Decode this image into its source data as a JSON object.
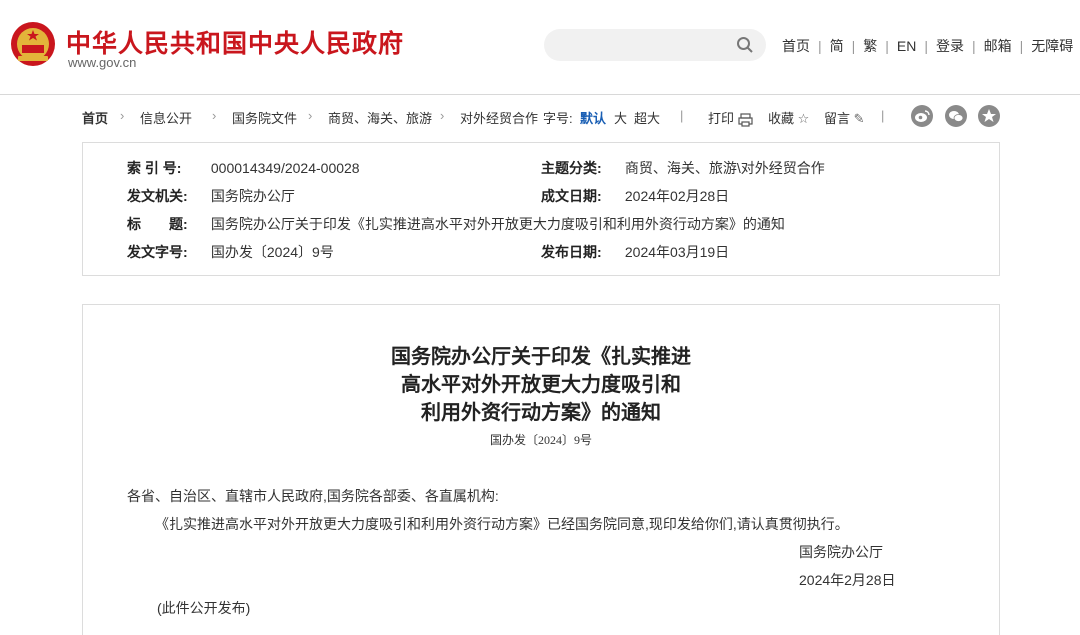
{
  "header": {
    "site_title": "中华人民共和国中央人民政府",
    "site_url": "www.gov.cn",
    "search_placeholder": "",
    "nav": [
      "首页",
      "简",
      "繁",
      "EN",
      "登录",
      "邮箱",
      "无障碍"
    ],
    "colors": {
      "brand_red": "#c9161d"
    }
  },
  "breadcrumb": {
    "items": [
      "首页",
      "信息公开",
      "国务院文件",
      "商贸、海关、旅游",
      "对外经贸合作"
    ],
    "font_size_label": "字号:",
    "font_sizes": [
      "默认",
      "大",
      "超大"
    ],
    "tools": [
      "打印",
      "收藏",
      "留言"
    ],
    "social_icons": [
      "weibo-icon",
      "wechat-icon",
      "qzone-icon"
    ]
  },
  "meta": {
    "index_label": "索 引 号:",
    "index_value": "000014349/2024-00028",
    "topic_label": "主题分类:",
    "topic_value": "商贸、海关、旅游\\对外经贸合作",
    "issuer_label": "发文机关:",
    "issuer_value": "国务院办公厅",
    "written_label": "成文日期:",
    "written_value": "2024年02月28日",
    "title_label": "标　　题:",
    "title_value": "国务院办公厅关于印发《扎实推进高水平对外开放更大力度吸引和利用外资行动方案》的通知",
    "docno_label": "发文字号:",
    "docno_value": "国办发〔2024〕9号",
    "published_label": "发布日期:",
    "published_value": "2024年03月19日"
  },
  "document": {
    "title_lines": [
      "国务院办公厅关于印发《扎实推进",
      "高水平对外开放更大力度吸引和",
      "利用外资行动方案》的通知"
    ],
    "doc_number": "国办发〔2024〕9号",
    "salutation": "各省、自治区、直辖市人民政府,国务院各部委、各直属机构:",
    "body": "《扎实推进高水平对外开放更大力度吸引和利用外资行动方案》已经国务院同意,现印发给你们,请认真贯彻执行。",
    "signature": "国务院办公厅",
    "date": "2024年2月28日",
    "note": "(此件公开发布)"
  }
}
